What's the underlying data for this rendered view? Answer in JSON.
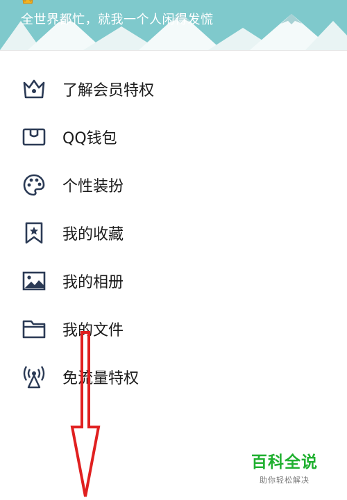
{
  "header": {
    "signature": "全世界都忙，就我一个人闲得发慌",
    "background_color": "#7fc9cc"
  },
  "menu": {
    "items": [
      {
        "icon": "crown-icon",
        "label": "了解会员特权"
      },
      {
        "icon": "wallet-icon",
        "label": "QQ钱包"
      },
      {
        "icon": "palette-icon",
        "label": "个性装扮"
      },
      {
        "icon": "bookmark-star-icon",
        "label": "我的收藏"
      },
      {
        "icon": "image-icon",
        "label": "我的相册"
      },
      {
        "icon": "folder-icon",
        "label": "我的文件"
      },
      {
        "icon": "signal-tower-icon",
        "label": "免流量特权"
      }
    ]
  },
  "annotation": {
    "arrow_color": "#e02020",
    "direction": "down"
  },
  "watermark": {
    "title": "百科全说",
    "subtitle": "助你轻松解决",
    "color": "#20b030"
  }
}
